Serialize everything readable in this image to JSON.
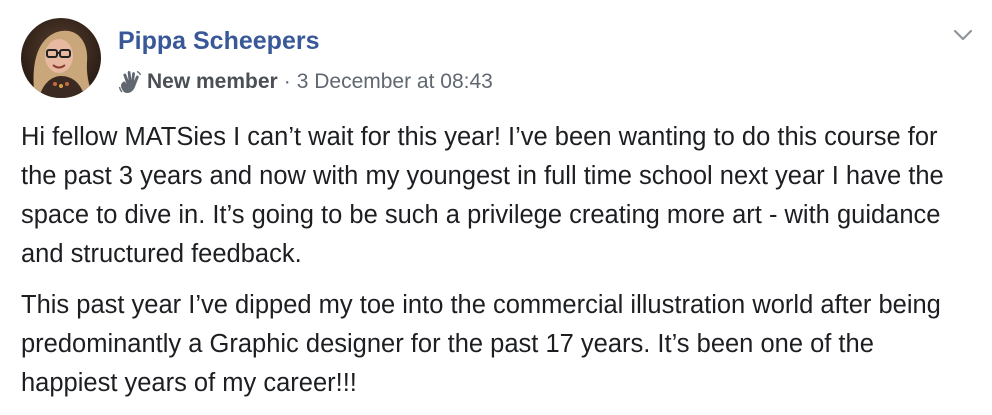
{
  "post": {
    "author_name": "Pippa Scheepers",
    "badge_icon": "waving-hand-icon",
    "badge_label": "New member",
    "separator": "·",
    "timestamp": "3 December at 08:43",
    "menu_icon": "chevron-down-icon",
    "paragraphs": [
      "Hi fellow MATSies I can’t wait for this year! I’ve been wanting to do this course for the past 3 years and now with my youngest in full time school next year I have the space to dive in. It’s going to be such a privilege creating more art - with guidance and structured feedback.",
      "This past year I’ve dipped my toe into the commercial illustration world after being predominantly a Graphic designer for the past 17 years. It’s been one of the happiest years of my career!!!"
    ]
  },
  "colors": {
    "author": "#385898",
    "meta": "#616770",
    "text": "#1c1e21",
    "chevron": "#90949c"
  }
}
